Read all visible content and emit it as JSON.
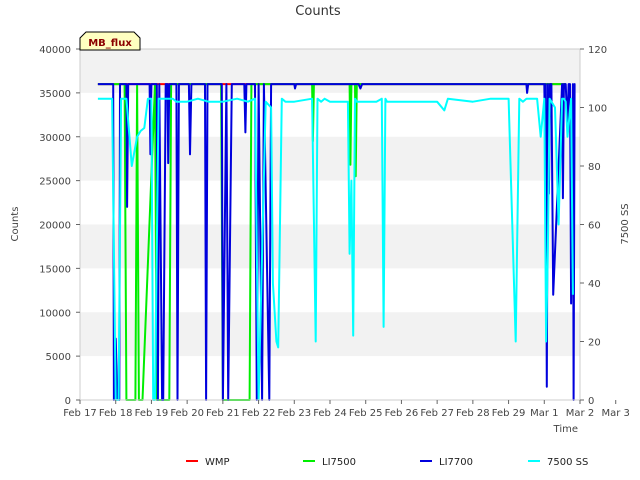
{
  "chart_data": {
    "type": "line",
    "title": "Counts",
    "xlabel": "Time",
    "ylabel": "Counts",
    "y2label": "7500 SS",
    "tag_label": "MB_flux",
    "xlim": [
      17,
      31
    ],
    "ylim": [
      0,
      40000
    ],
    "y2lim": [
      0,
      120
    ],
    "x_ticks": [
      17,
      18,
      19,
      20,
      21,
      22,
      23,
      24,
      25,
      26,
      27,
      28,
      29,
      30,
      31,
      32
    ],
    "x_tick_labels": [
      "Feb 17",
      "Feb 18",
      "Feb 19",
      "Feb 20",
      "Feb 21",
      "Feb 22",
      "Feb 23",
      "Feb 24",
      "Feb 25",
      "Feb 26",
      "Feb 27",
      "Feb 28",
      "Feb 29",
      "Mar 1",
      "Mar 2",
      "Mar 3"
    ],
    "y_ticks": [
      0,
      5000,
      10000,
      15000,
      20000,
      25000,
      30000,
      35000,
      40000
    ],
    "y2_ticks": [
      0,
      20,
      40,
      60,
      80,
      100,
      120
    ],
    "grid": "horizontal bands",
    "legend_position": "bottom",
    "series": [
      {
        "name": "WMP",
        "color": "#ff0000",
        "axis": "left",
        "x": [
          17.5,
          30.6
        ],
        "y": [
          36000,
          36000
        ]
      },
      {
        "name": "LI7500",
        "color": "#00ee00",
        "axis": "left",
        "x": [
          17.5,
          18.25,
          18.3,
          18.55,
          18.6,
          18.65,
          18.75,
          19.1,
          19.15,
          19.5,
          19.55,
          20.95,
          21.0,
          21.75,
          21.8,
          23.5,
          23.52,
          23.55,
          24.55,
          24.57,
          24.6,
          24.7,
          24.72,
          24.75,
          30.6
        ],
        "y": [
          36000,
          36000,
          0,
          0,
          36000,
          0,
          0,
          36000,
          0,
          0,
          36000,
          36000,
          0,
          0,
          36000,
          36000,
          29500,
          36000,
          36000,
          26800,
          36000,
          36000,
          25500,
          36000,
          36000
        ]
      },
      {
        "name": "LI7700",
        "color": "#0000dd",
        "axis": "left",
        "x": [
          17.5,
          17.93,
          17.95,
          18.0,
          18.05,
          18.1,
          18.12,
          18.3,
          18.32,
          18.35,
          18.95,
          18.97,
          19.0,
          19.15,
          19.18,
          19.22,
          19.3,
          19.33,
          19.4,
          19.45,
          19.47,
          19.5,
          19.7,
          19.73,
          19.77,
          20.05,
          20.08,
          20.12,
          20.5,
          20.53,
          20.57,
          20.97,
          21.0,
          21.1,
          21.15,
          21.25,
          21.3,
          21.6,
          21.63,
          21.66,
          21.9,
          21.95,
          22.0,
          22.1,
          22.15,
          22.3,
          22.35,
          22.5,
          23.0,
          23.02,
          23.05,
          24.8,
          24.85,
          24.9,
          29.5,
          29.52,
          29.55,
          30.0,
          30.02,
          30.04,
          30.07,
          30.1,
          30.13,
          30.16,
          30.2,
          30.25,
          30.5,
          30.52,
          30.55,
          30.6,
          30.65,
          30.68,
          30.72,
          30.75,
          30.78,
          30.8,
          30.82,
          30.85,
          30.87
        ],
        "y": [
          36000,
          36000,
          0,
          7000,
          0,
          0,
          36000,
          36000,
          22000,
          36000,
          36000,
          28000,
          36000,
          36000,
          0,
          36000,
          0,
          0,
          36000,
          36000,
          27000,
          36000,
          36000,
          0,
          36000,
          36000,
          28000,
          36000,
          36000,
          0,
          36000,
          36000,
          0,
          36000,
          0,
          36000,
          36000,
          36000,
          30500,
          36000,
          36000,
          0,
          36000,
          0,
          36000,
          0,
          36000,
          36000,
          36000,
          35500,
          36000,
          36000,
          35500,
          36000,
          36000,
          35000,
          36000,
          36000,
          30000,
          36000,
          1500,
          36000,
          23500,
          36000,
          36000,
          12000,
          36000,
          23000,
          36000,
          36000,
          31000,
          36000,
          36000,
          11000,
          21000,
          36000,
          0,
          36000,
          36000
        ]
      },
      {
        "name": "7500 SS",
        "color": "#00ffff",
        "axis": "right",
        "x": [
          17.5,
          17.9,
          18.0,
          18.08,
          18.15,
          18.3,
          18.45,
          18.6,
          18.7,
          18.8,
          18.9,
          19.0,
          19.05,
          19.1,
          19.2,
          19.3,
          19.5,
          19.6,
          19.7,
          20.0,
          20.3,
          20.6,
          21.0,
          21.4,
          21.7,
          21.9,
          22.0,
          22.2,
          22.35,
          22.4,
          22.5,
          22.55,
          22.65,
          22.75,
          23.0,
          23.5,
          23.6,
          23.65,
          23.75,
          23.85,
          24.0,
          24.5,
          24.55,
          24.6,
          24.65,
          24.7,
          24.75,
          25.0,
          25.3,
          25.45,
          25.5,
          25.55,
          25.6,
          25.7,
          26.0,
          26.5,
          27.0,
          27.2,
          27.3,
          28.0,
          28.5,
          29.0,
          29.2,
          29.3,
          29.4,
          29.5,
          29.8,
          29.9,
          30.0,
          30.05,
          30.1,
          30.15,
          30.2,
          30.3,
          30.4,
          30.5,
          30.55,
          30.6,
          30.65,
          30.75,
          30.8
        ],
        "y": [
          103,
          103,
          0,
          0,
          103,
          103,
          80,
          90,
          92,
          93,
          103,
          103,
          0,
          0,
          103,
          103,
          103,
          103,
          102,
          102,
          103,
          102,
          102,
          103,
          102,
          103,
          0,
          102,
          100,
          40,
          20,
          18,
          103,
          102,
          102,
          103,
          20,
          103,
          102,
          103,
          102,
          102,
          50,
          75,
          22,
          103,
          102,
          102,
          102,
          103,
          25,
          103,
          102,
          102,
          102,
          102,
          102,
          99,
          103,
          102,
          103,
          103,
          20,
          103,
          102,
          103,
          103,
          90,
          103,
          20,
          52,
          103,
          102,
          100,
          60,
          103,
          103,
          102,
          90,
          103,
          36
        ]
      }
    ]
  }
}
